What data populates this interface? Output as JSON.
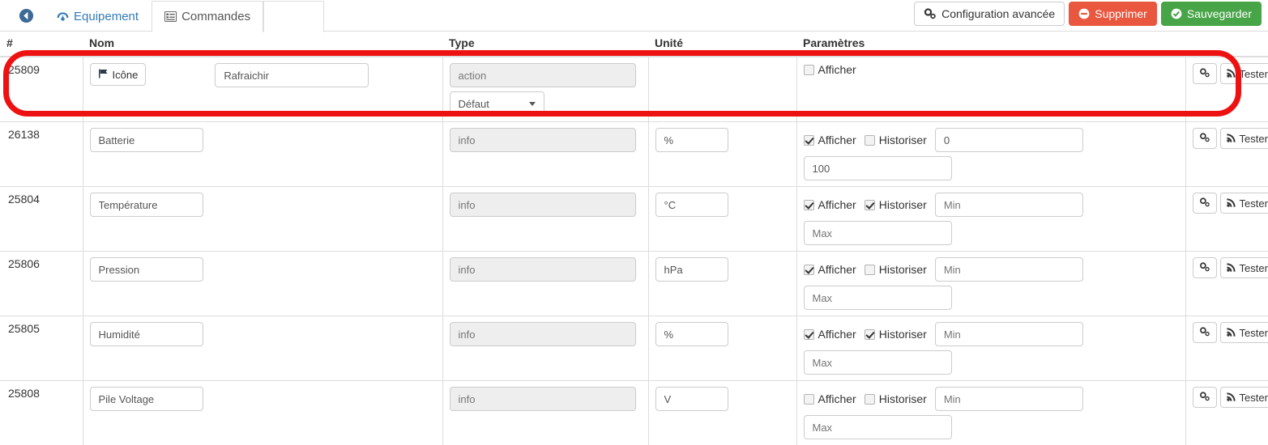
{
  "topbar": {
    "back_icon": "arrow-circle-left-icon",
    "tabs": [
      {
        "label": "Equipement",
        "icon": "dashboard-icon",
        "active": false
      },
      {
        "label": "Commandes",
        "icon": "list-alt-icon",
        "active": true
      }
    ],
    "buttons": {
      "advanced_config": {
        "label": "Configuration avancée",
        "icon": "cogs-icon",
        "color": "#ffffff"
      },
      "delete": {
        "label": "Supprimer",
        "icon": "minus-circle-icon",
        "color": "#e9573f"
      },
      "save": {
        "label": "Sauvegarder",
        "icon": "check-circle-icon",
        "color": "#47a447"
      }
    }
  },
  "table": {
    "headers": {
      "id": "#",
      "name": "Nom",
      "type": "Type",
      "unit": "Unité",
      "params": "Paramètres",
      "actions": "",
      "delete": ""
    },
    "labels": {
      "icone_button": "Icône",
      "afficher": "Afficher",
      "historiser": "Historiser",
      "tester": "Tester",
      "min_placeholder": "Min",
      "max_placeholder": "Max",
      "config_icon": "cogs-icon",
      "tester_icon": "rss-icon",
      "delete_icon": "minus-circle-filled-icon",
      "flag_icon": "flag-icon"
    },
    "rows": [
      {
        "id": "25809",
        "has_icon_button": true,
        "name_value": "Rafraichir",
        "type_value": "action",
        "has_subtype": true,
        "subtype_value": "Défaut",
        "unit_value": "",
        "show_unit": false,
        "afficher_checked": false,
        "has_historiser": false,
        "historiser_checked": false,
        "has_minmax": false,
        "min_value": "",
        "max_value": "",
        "highlighted": true
      },
      {
        "id": "26138",
        "has_icon_button": false,
        "name_value": "Batterie",
        "type_value": "info",
        "has_subtype": false,
        "subtype_value": "",
        "unit_value": "%",
        "show_unit": true,
        "afficher_checked": true,
        "has_historiser": true,
        "historiser_checked": false,
        "has_minmax": true,
        "min_value": "0",
        "max_value": "100",
        "highlighted": false
      },
      {
        "id": "25804",
        "has_icon_button": false,
        "name_value": "Température",
        "type_value": "info",
        "has_subtype": false,
        "subtype_value": "",
        "unit_value": "°C",
        "show_unit": true,
        "afficher_checked": true,
        "has_historiser": true,
        "historiser_checked": true,
        "has_minmax": true,
        "min_value": "",
        "max_value": "",
        "highlighted": false
      },
      {
        "id": "25806",
        "has_icon_button": false,
        "name_value": "Pression",
        "type_value": "info",
        "has_subtype": false,
        "subtype_value": "",
        "unit_value": "hPa",
        "show_unit": true,
        "afficher_checked": true,
        "has_historiser": true,
        "historiser_checked": false,
        "has_minmax": true,
        "min_value": "",
        "max_value": "",
        "highlighted": false
      },
      {
        "id": "25805",
        "has_icon_button": false,
        "name_value": "Humidité",
        "type_value": "info",
        "has_subtype": false,
        "subtype_value": "",
        "unit_value": "%",
        "show_unit": true,
        "afficher_checked": true,
        "has_historiser": true,
        "historiser_checked": true,
        "has_minmax": true,
        "min_value": "",
        "max_value": "",
        "highlighted": false
      },
      {
        "id": "25808",
        "has_icon_button": false,
        "name_value": "Pile Voltage",
        "type_value": "info",
        "has_subtype": false,
        "subtype_value": "",
        "unit_value": "V",
        "show_unit": true,
        "afficher_checked": false,
        "has_historiser": true,
        "historiser_checked": false,
        "has_minmax": true,
        "min_value": "",
        "max_value": "",
        "highlighted": false
      }
    ]
  },
  "annotation": {
    "shape": "rounded-rectangle",
    "color": "#ee1111",
    "target_row_id": "25809"
  }
}
